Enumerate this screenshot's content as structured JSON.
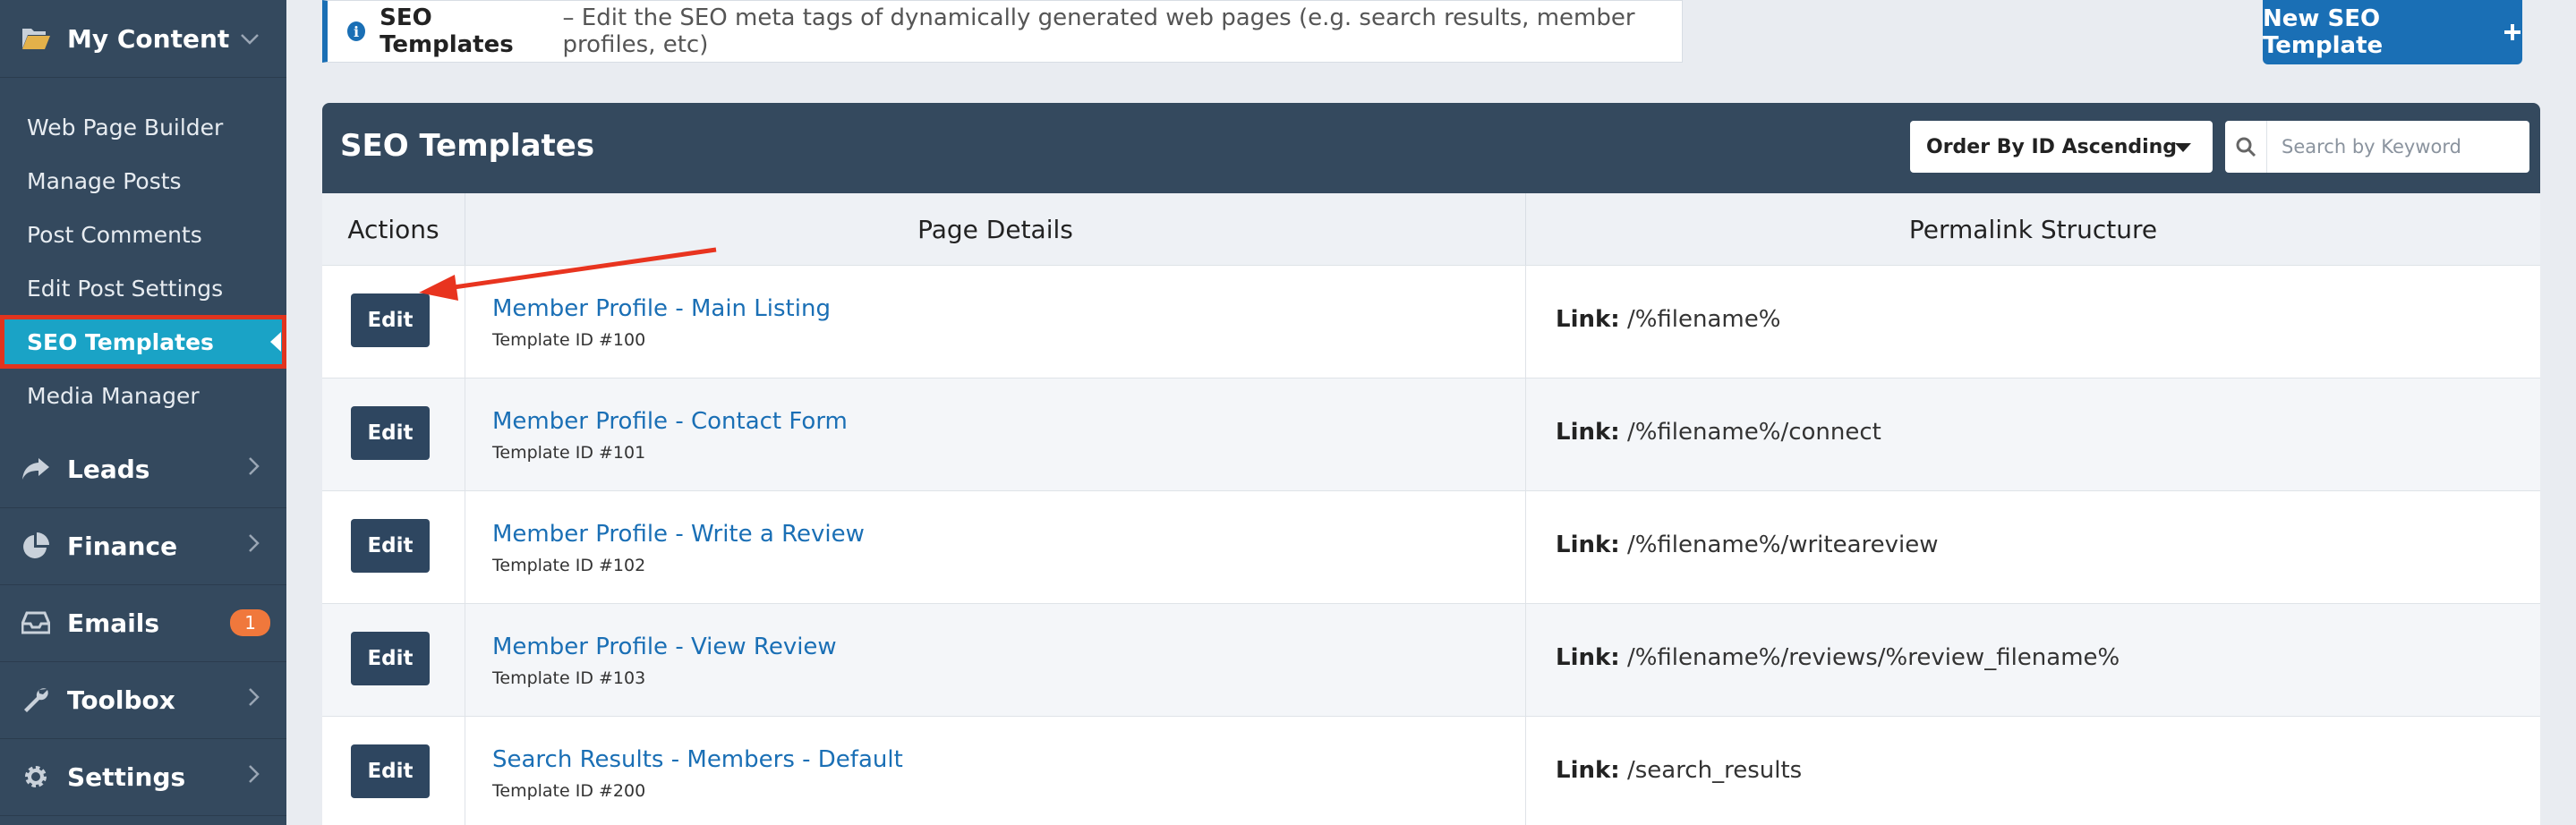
{
  "sidebar": {
    "sections": [
      {
        "label": "My Content",
        "icon": "folder-open-icon"
      },
      {
        "label": "Leads",
        "icon": "share-arrow-icon"
      },
      {
        "label": "Finance",
        "icon": "pie-chart-icon"
      },
      {
        "label": "Emails",
        "icon": "inbox-icon",
        "badge": "1"
      },
      {
        "label": "Toolbox",
        "icon": "wrench-icon"
      },
      {
        "label": "Settings",
        "icon": "gear-icon"
      }
    ],
    "subitems": [
      {
        "label": "Web Page Builder"
      },
      {
        "label": "Manage Posts"
      },
      {
        "label": "Post Comments"
      },
      {
        "label": "Edit Post Settings"
      },
      {
        "label": "SEO Templates",
        "active": true
      },
      {
        "label": "Media Manager"
      }
    ]
  },
  "info": {
    "title": "SEO Templates",
    "text": "– Edit the SEO meta tags of dynamically generated web pages (e.g. search results, member profiles, etc)"
  },
  "new_button": {
    "label": "New SEO Template",
    "icon": "plus-icon"
  },
  "panel": {
    "title": "SEO Templates",
    "order_select": "Order By ID Ascending",
    "search_placeholder": "Search by Keyword",
    "columns": {
      "actions": "Actions",
      "details": "Page Details",
      "permalink": "Permalink Structure"
    },
    "edit_label": "Edit",
    "link_label": "Link:",
    "rows": [
      {
        "name": "Member Profile - Main Listing",
        "template_id": "Template ID #100",
        "link": "/%filename%"
      },
      {
        "name": "Member Profile - Contact Form",
        "template_id": "Template ID #101",
        "link": "/%filename%/connect"
      },
      {
        "name": "Member Profile - Write a Review",
        "template_id": "Template ID #102",
        "link": "/%filename%/writeareview"
      },
      {
        "name": "Member Profile - View Review",
        "template_id": "Template ID #103",
        "link": "/%filename%/reviews/%review_filename%"
      },
      {
        "name": "Search Results - Members - Default",
        "template_id": "Template ID #200",
        "link": "/search_results"
      }
    ]
  },
  "colors": {
    "sidebar": "#34495e",
    "accent": "#1a6fb5",
    "active": "#1aa3c6",
    "highlight": "#e1341e",
    "badge": "#f0783c"
  }
}
